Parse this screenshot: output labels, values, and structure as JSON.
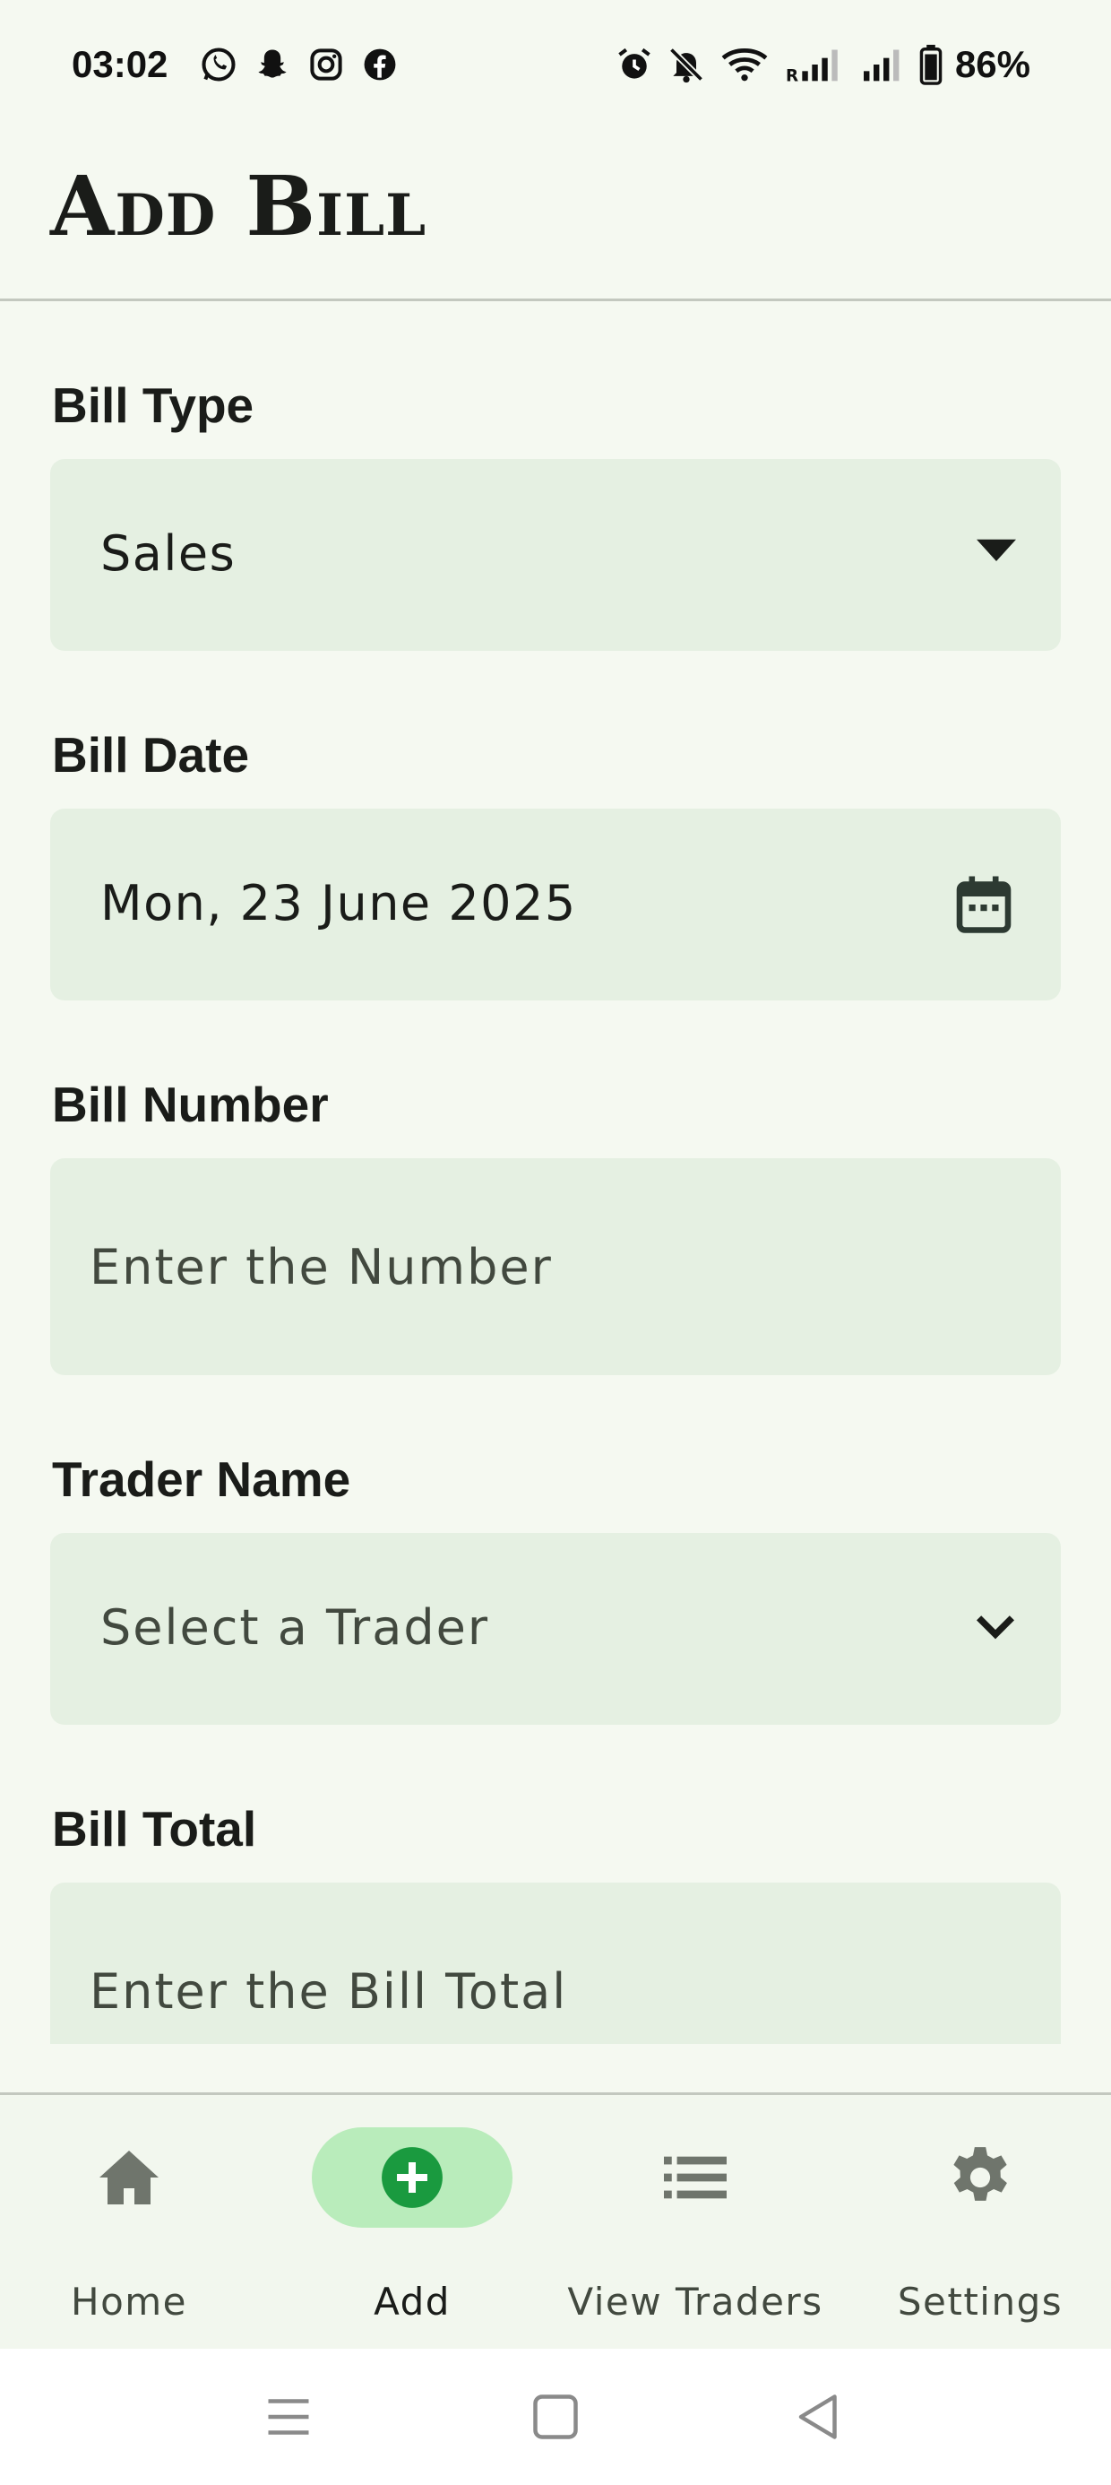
{
  "status_bar": {
    "time": "03:02",
    "battery": "86%",
    "left_icons": [
      "whatsapp-icon",
      "snapchat-icon",
      "instagram-icon",
      "facebook-icon"
    ],
    "right_icons": [
      "alarm-icon",
      "bell-off-icon",
      "wifi-icon",
      "signal-r-icon",
      "signal-icon",
      "battery-icon"
    ]
  },
  "app_bar": {
    "title": "Add Bill"
  },
  "form": {
    "bill_type": {
      "label": "Bill Type",
      "value": "Sales"
    },
    "bill_date": {
      "label": "Bill Date",
      "value": "Mon, 23 June 2025"
    },
    "bill_number": {
      "label": "Bill Number",
      "placeholder": "Enter the Number"
    },
    "trader_name": {
      "label": "Trader Name",
      "placeholder": "Select a Trader"
    },
    "bill_total": {
      "label": "Bill Total",
      "placeholder": "Enter the Bill Total"
    }
  },
  "bottom_nav": {
    "items": [
      {
        "label": "Home",
        "icon": "home-icon",
        "active": false
      },
      {
        "label": "Add",
        "icon": "add-circle-icon",
        "active": true
      },
      {
        "label": "View Traders",
        "icon": "list-icon",
        "active": false
      },
      {
        "label": "Settings",
        "icon": "gear-icon",
        "active": false
      }
    ]
  },
  "colors": {
    "background": "#f5f9f1",
    "field_fill": "#e5f0e2",
    "active_pill": "#b9ecbb",
    "accent_green": "#1a9a3f"
  }
}
